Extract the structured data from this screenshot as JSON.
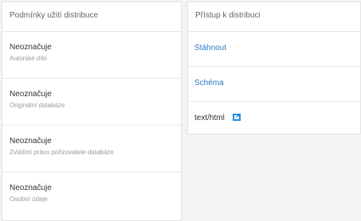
{
  "conditions": {
    "header": "Podmínky užití distribuce",
    "items": [
      {
        "title": "Neoznačuje",
        "subtitle": "Autorské dílo"
      },
      {
        "title": "Neoznačuje",
        "subtitle": "Originální databáze"
      },
      {
        "title": "Neoznačuje",
        "subtitle": "Zvláštní právo pořizovatele databáze"
      },
      {
        "title": "Neoznačuje",
        "subtitle": "Osobní údaje"
      }
    ]
  },
  "access": {
    "header": "Přístup k distribuci",
    "items": [
      {
        "label": "Stáhnout",
        "type": "link"
      },
      {
        "label": "Schéma",
        "type": "link"
      },
      {
        "label": "text/html",
        "type": "text",
        "icon": "external-link-icon"
      }
    ]
  },
  "colors": {
    "link": "#2a79c4",
    "icon": "#1f8fe0"
  }
}
